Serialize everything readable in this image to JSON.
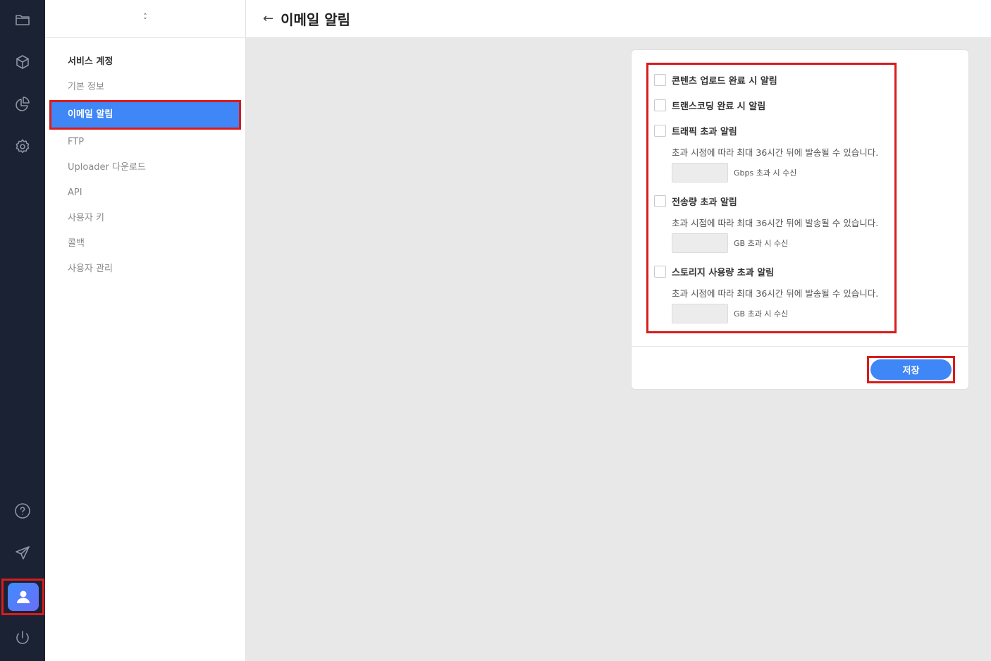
{
  "header": {
    "back_icon": "arrow-left-icon",
    "title": "이메일 알림"
  },
  "rail": {
    "top_icons": [
      "folder-icon",
      "cube-icon",
      "pie-chart-icon",
      "gear-icon"
    ],
    "bottom_icons": [
      "help-icon",
      "send-icon",
      "user-avatar",
      "power-icon"
    ]
  },
  "subnav": {
    "switcher_icon": "chevron-updown-icon",
    "section_label": "서비스 계정",
    "items": [
      {
        "label": "기본 정보",
        "active": false
      },
      {
        "label": "이메일 알림",
        "active": true
      },
      {
        "label": "FTP",
        "active": false
      },
      {
        "label": "Uploader 다운로드",
        "active": false
      },
      {
        "label": "API",
        "active": false
      },
      {
        "label": "사용자 키",
        "active": false
      },
      {
        "label": "콜백",
        "active": false
      },
      {
        "label": "사용자 관리",
        "active": false
      }
    ]
  },
  "options": {
    "upload_complete": {
      "label": "콘텐츠 업로드 완료 시 알림",
      "checked": false
    },
    "transcoding_complete": {
      "label": "트랜스코딩 완료 시 알림",
      "checked": false
    },
    "traffic": {
      "label": "트래픽 초과 알림",
      "checked": false,
      "desc": "초과 시점에 따라 최대 36시간 뒤에 발송될 수 있습니다.",
      "value": "",
      "unit": "Gbps 초과 시 수신"
    },
    "transfer": {
      "label": "전송량 초과 알림",
      "checked": false,
      "desc": "초과 시점에 따라 최대 36시간 뒤에 발송될 수 있습니다.",
      "value": "",
      "unit": "GB 초과 시 수신"
    },
    "storage": {
      "label": "스토리지 사용량 초과 알림",
      "checked": false,
      "desc": "초과 시점에 따라 최대 36시간 뒤에 발송될 수 있습니다.",
      "value": "",
      "unit": "GB 초과 시 수신"
    }
  },
  "actions": {
    "save_label": "저장"
  },
  "colors": {
    "accent": "#3f86f7",
    "rail_bg": "#1b2233",
    "highlight": "#d91c1c"
  }
}
